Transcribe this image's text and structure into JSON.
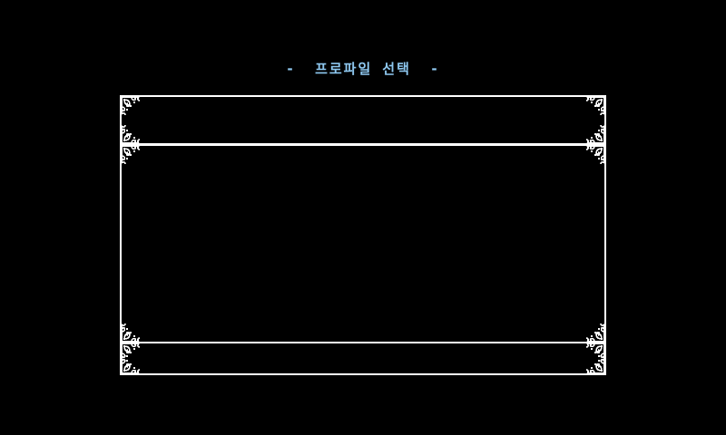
{
  "screen": {
    "title": "프로파일 선택",
    "title_prefix": "-",
    "title_suffix": "-"
  },
  "colors": {
    "background": "#000000",
    "title": "#8ec8f0",
    "frame": "#ffffff"
  },
  "icons": {
    "corner": "ornate-flourish-icon"
  }
}
